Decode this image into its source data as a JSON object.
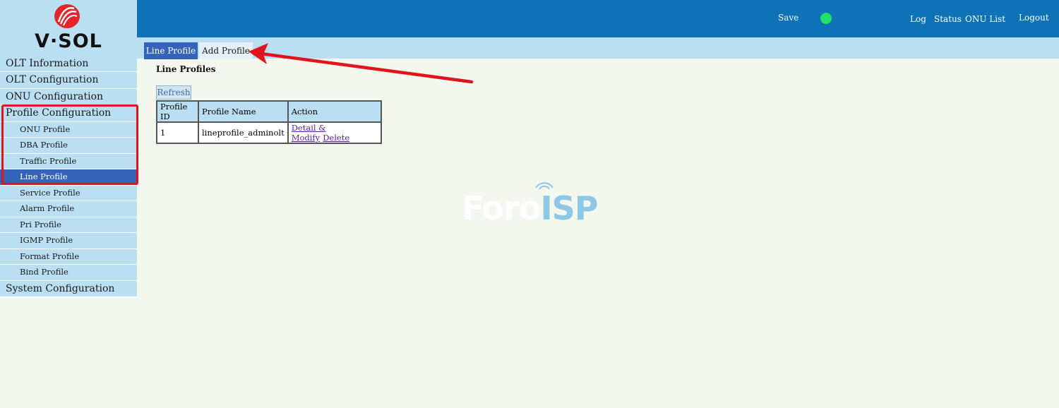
{
  "header": {
    "save_label": "Save",
    "nav": {
      "log": "Log",
      "status": "Status",
      "onu_list": "ONU List",
      "logout": "Logout"
    },
    "status_color": "#22e06a"
  },
  "logo": {
    "text": "V·SOL"
  },
  "sidebar": {
    "top_items": [
      "OLT Information",
      "OLT Configuration",
      "ONU Configuration",
      "Profile Configuration"
    ],
    "sub_items": [
      "ONU Profile",
      "DBA Profile",
      "Traffic Profile",
      "Line Profile",
      "Service Profile",
      "Alarm Profile",
      "Pri Profile",
      "IGMP Profile",
      "Format Profile",
      "Bind Profile"
    ],
    "bottom_item": "System Configuration",
    "active_item": "Line Profile"
  },
  "tabs": {
    "line_profile": "Line Profile",
    "add_profile": "Add Profile"
  },
  "main": {
    "title": "Line Profiles",
    "refresh_label": "Refresh",
    "table": {
      "headers": [
        "Profile ID",
        "Profile Name",
        "Action"
      ],
      "rows": [
        {
          "id": "1",
          "name": "lineprofile_adminolt",
          "detail_link": "Detail & Modify",
          "delete_link": "Delete"
        }
      ]
    }
  },
  "watermark": {
    "foro": "Foro",
    "isp": "ISP"
  },
  "colors": {
    "header_blue": "#0e73b6",
    "menu_bg": "#bbdff2",
    "active_blue": "#3563b8",
    "annotation_red": "#e0141a"
  }
}
